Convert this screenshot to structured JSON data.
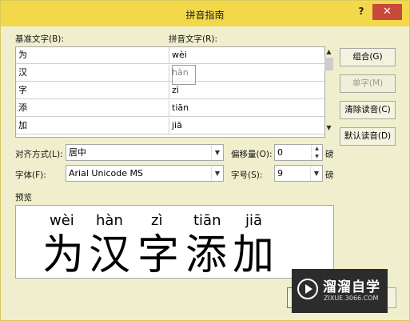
{
  "window": {
    "title": "拼音指南",
    "help_label": "?",
    "close_label": "✕"
  },
  "labels": {
    "base_text": "基准文字(B):",
    "ruby_text": "拼音文字(R):",
    "alignment": "对齐方式(L):",
    "offset": "偏移量(O):",
    "offset_unit": "磅",
    "font": "字体(F):",
    "size": "字号(S):",
    "size_unit": "磅",
    "preview": "预览"
  },
  "rows": [
    {
      "base": "为",
      "ruby": "wèi"
    },
    {
      "base": "汉",
      "ruby": "hàn"
    },
    {
      "base": "字",
      "ruby": "zì"
    },
    {
      "base": "添",
      "ruby": "tiān"
    },
    {
      "base": "加",
      "ruby": "jiā"
    }
  ],
  "buttons": {
    "group": "组合(G)",
    "mono": "单字(M)",
    "clear": "清除读音(C)",
    "default": "默认读音(D)"
  },
  "fields": {
    "alignment_value": "居中",
    "offset_value": "0",
    "font_value": "Arial Unicode MS",
    "size_value": "9"
  },
  "preview": {
    "ruby": [
      "wèi",
      "hàn",
      "zì",
      "tiān",
      "jiā"
    ],
    "text": [
      "为",
      "汉",
      "字",
      "添",
      "加"
    ]
  },
  "watermark": {
    "title": "溜溜自学",
    "url": "ZIXUE.3066.COM"
  },
  "colors": {
    "titlebar": "#f3d94a",
    "close": "#c7493c",
    "dialog_bg": "#f0efcd"
  }
}
